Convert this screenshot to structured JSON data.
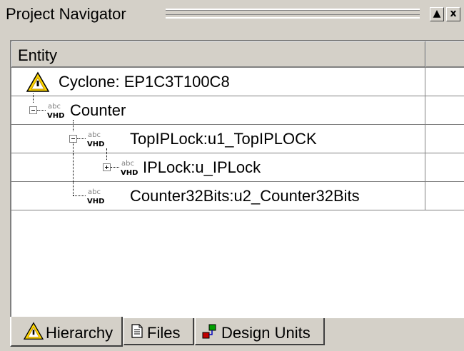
{
  "panel": {
    "title": "Project Navigator",
    "buttons": {
      "restore": "▲",
      "close": "x"
    }
  },
  "tree": {
    "columns": [
      "Entity",
      ""
    ],
    "rows": [
      {
        "label": "Cyclone: EP1C3T100C8",
        "icon": "warning-icon"
      },
      {
        "label": "Counter",
        "icon": "vhd-file-icon"
      },
      {
        "label": "TopIPLock:u1_TopIPLOCK",
        "icon": "vhd-file-icon"
      },
      {
        "label": "IPLock:u_IPLock",
        "icon": "vhd-file-icon"
      },
      {
        "label": "Counter32Bits:u2_Counter32Bits",
        "icon": "vhd-file-icon"
      }
    ]
  },
  "tabs": [
    {
      "label": "Hierarchy",
      "icon": "warning-icon",
      "active": true
    },
    {
      "label": "Files",
      "icon": "document-icon",
      "active": false
    },
    {
      "label": "Design Units",
      "icon": "design-units-icon",
      "active": false
    }
  ],
  "colors": {
    "face": "#d4d0c8",
    "warning": "#ffd700",
    "shadow": "#808080"
  }
}
